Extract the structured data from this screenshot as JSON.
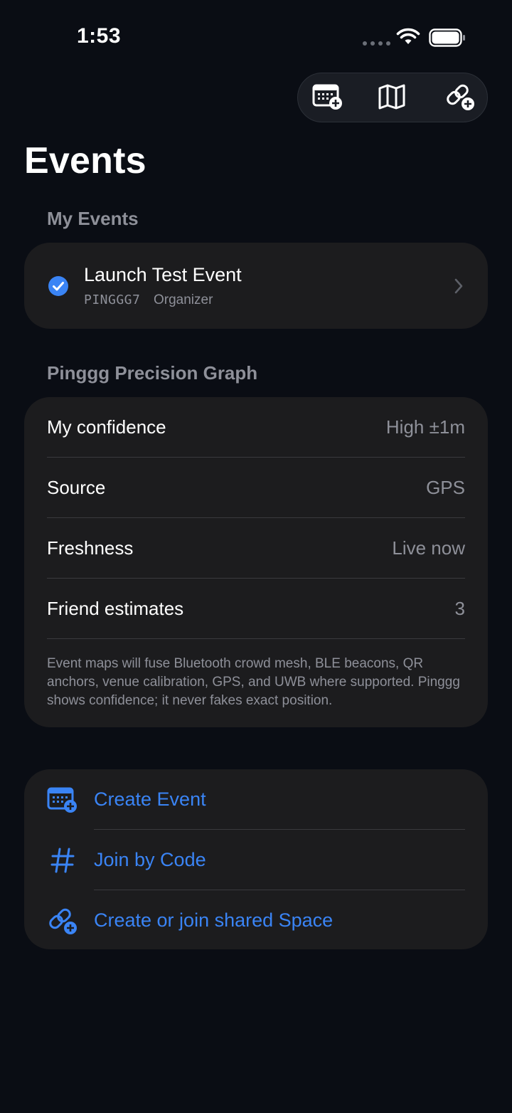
{
  "status_bar": {
    "time": "1:53",
    "icons": [
      "signal-dots-icon",
      "wifi-icon",
      "battery-icon"
    ]
  },
  "toolbar": {
    "buttons": [
      {
        "icon": "calendar-add-icon"
      },
      {
        "icon": "map-icon"
      },
      {
        "icon": "link-add-icon"
      }
    ]
  },
  "page": {
    "title": "Events"
  },
  "my_events": {
    "header": "My Events",
    "items": [
      {
        "title": "Launch Test Event",
        "code": "PINGGG7",
        "role": "Organizer",
        "icon": "checkmark-circle-icon"
      }
    ]
  },
  "precision_graph": {
    "header": "Pinggg Precision Graph",
    "rows": [
      {
        "key": "My confidence",
        "value": "High ±1m"
      },
      {
        "key": "Source",
        "value": "GPS"
      },
      {
        "key": "Freshness",
        "value": "Live now"
      },
      {
        "key": "Friend estimates",
        "value": "3"
      }
    ],
    "note": "Event maps will fuse Bluetooth crowd mesh, BLE beacons, QR anchors, venue calibration, GPS, and UWB where supported. Pinggg shows confidence; it never fakes exact position."
  },
  "actions": [
    {
      "label": "Create Event",
      "icon": "calendar-add-icon"
    },
    {
      "label": "Join by Code",
      "icon": "hash-icon"
    },
    {
      "label": "Create or join shared Space",
      "icon": "link-add-icon"
    }
  ],
  "colors": {
    "background": "#0a0d14",
    "card": "#1c1c1e",
    "accent": "#3a84f5",
    "secondary_text": "#8e9099"
  }
}
